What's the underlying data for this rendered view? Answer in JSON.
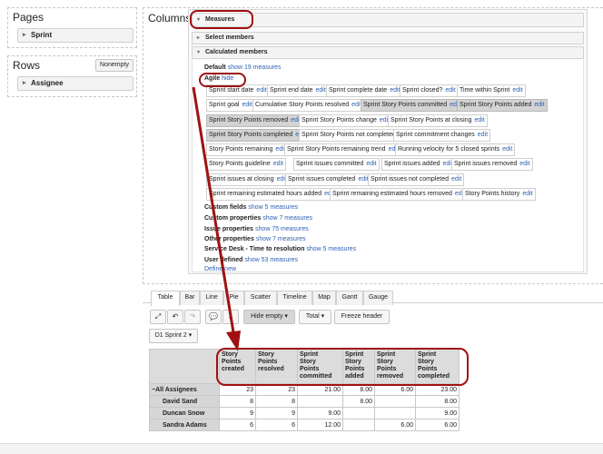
{
  "sidebar": {
    "pages_title": "Pages",
    "pages_item": "Sprint",
    "rows_title": "Rows",
    "nonempty": "Nonempty",
    "rows_item": "Assignee"
  },
  "columns": {
    "title": "Columns",
    "measures": "Measures",
    "select_members": "Select members",
    "calculated_members": "Calculated members",
    "default_label": "Default",
    "default_link": "show 19 measures",
    "agile_label": "Agile",
    "agile_link": "hide",
    "edit": "edit",
    "tags": [
      "Sprint start date",
      "Sprint end date",
      "Sprint complete date",
      "Sprint closed?",
      "Time within Sprint",
      "Sprint goal",
      "Cumulative Story Points resolved",
      "Sprint Story Points committed",
      "Sprint Story Points added",
      "Sprint Story Points removed",
      "Sprint Story Points change",
      "Sprint Story Points at closing",
      "Sprint Story Points completed",
      "Sprint Story Points not completed",
      "Sprint commitment changes",
      "Story Points remaining",
      "Sprint Story Points remaining trend",
      "Running velocity for 5 closed sprints",
      "Story Points guideline",
      "Sprint issues committed",
      "Sprint issues added",
      "Sprint issues removed",
      "Sprint issues at closing",
      "Sprint issues completed",
      "Sprint issues not completed",
      "Sprint remaining estimated hours added",
      "Sprint remaining estimated hours removed",
      "Story Points history"
    ],
    "groups": [
      {
        "label": "Custom fields",
        "link": "show 5 measures"
      },
      {
        "label": "Custom properties",
        "link": "show 7 measures"
      },
      {
        "label": "Issue properties",
        "link": "show 75 measures"
      },
      {
        "label": "Other properties",
        "link": "show 7 measures"
      },
      {
        "label": "Service Desk - Time to resolution",
        "link": "show 5 measures"
      },
      {
        "label": "User defined",
        "link": "show 53 measures"
      }
    ],
    "define_new": "Define new"
  },
  "tabs": [
    "Table",
    "Bar",
    "Line",
    "Pie",
    "Scatter",
    "Timeline",
    "Map",
    "Gantt",
    "Gauge"
  ],
  "toolbar": {
    "hide_empty": "Hide empty",
    "total": "Total",
    "freeze_header": "Freeze header",
    "page_select": "D1 Sprint 2"
  },
  "table": {
    "headers": [
      "Story\nPoints\ncreated",
      "Story\nPoints\nresolved",
      "Sprint\nStory\nPoints\ncommitted",
      "Sprint\nStory\nPoints\nadded",
      "Sprint\nStory\nPoints\nremoved",
      "Sprint\nStory\nPoints\ncompleted"
    ],
    "rows": [
      {
        "name": "All Assignees",
        "values": [
          "23",
          "23",
          "21.00",
          "8.00",
          "6.00",
          "23.00"
        ]
      },
      {
        "name": "David Sand",
        "values": [
          "8",
          "8",
          "",
          "8.00",
          "",
          "8.00"
        ]
      },
      {
        "name": "Duncan Snow",
        "values": [
          "9",
          "9",
          "9.00",
          "",
          "",
          "9.00"
        ]
      },
      {
        "name": "Sandra Adams",
        "values": [
          "6",
          "6",
          "12.00",
          "",
          "6.00",
          "6.00"
        ]
      }
    ]
  },
  "colors": {
    "annotation": "#a01010",
    "link": "#2f62b3"
  }
}
